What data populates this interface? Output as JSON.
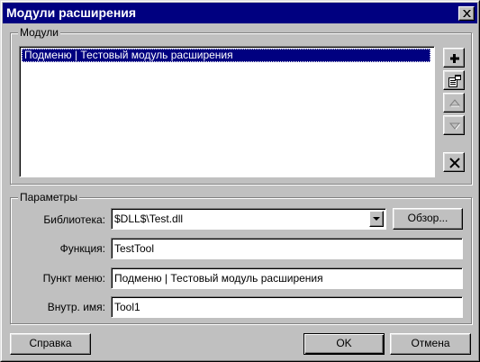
{
  "window": {
    "title": "Модули расширения"
  },
  "modules": {
    "legend": "Модули",
    "items": [
      "Подменю | Тестовый модуль расширения"
    ]
  },
  "side_buttons": {
    "add": "plus-icon",
    "properties": "properties-icon",
    "up": "arrow-up-icon",
    "down": "arrow-down-icon",
    "delete": "x-icon"
  },
  "params": {
    "legend": "Параметры",
    "library_label": "Библиотека:",
    "library_value": "$DLL$\\Test.dll",
    "browse_label": "Обзор...",
    "function_label": "Функция:",
    "function_value": "TestTool",
    "menu_label": "Пункт меню:",
    "menu_value": "Подменю | Тестовый модуль расширения",
    "internal_label": "Внутр. имя:",
    "internal_value": "Tool1"
  },
  "footer": {
    "help": "Справка",
    "ok": "OK",
    "cancel": "Отмена"
  },
  "colors": {
    "titlebar": "#000080",
    "face": "#c0c0c0",
    "selection": "#000080"
  }
}
